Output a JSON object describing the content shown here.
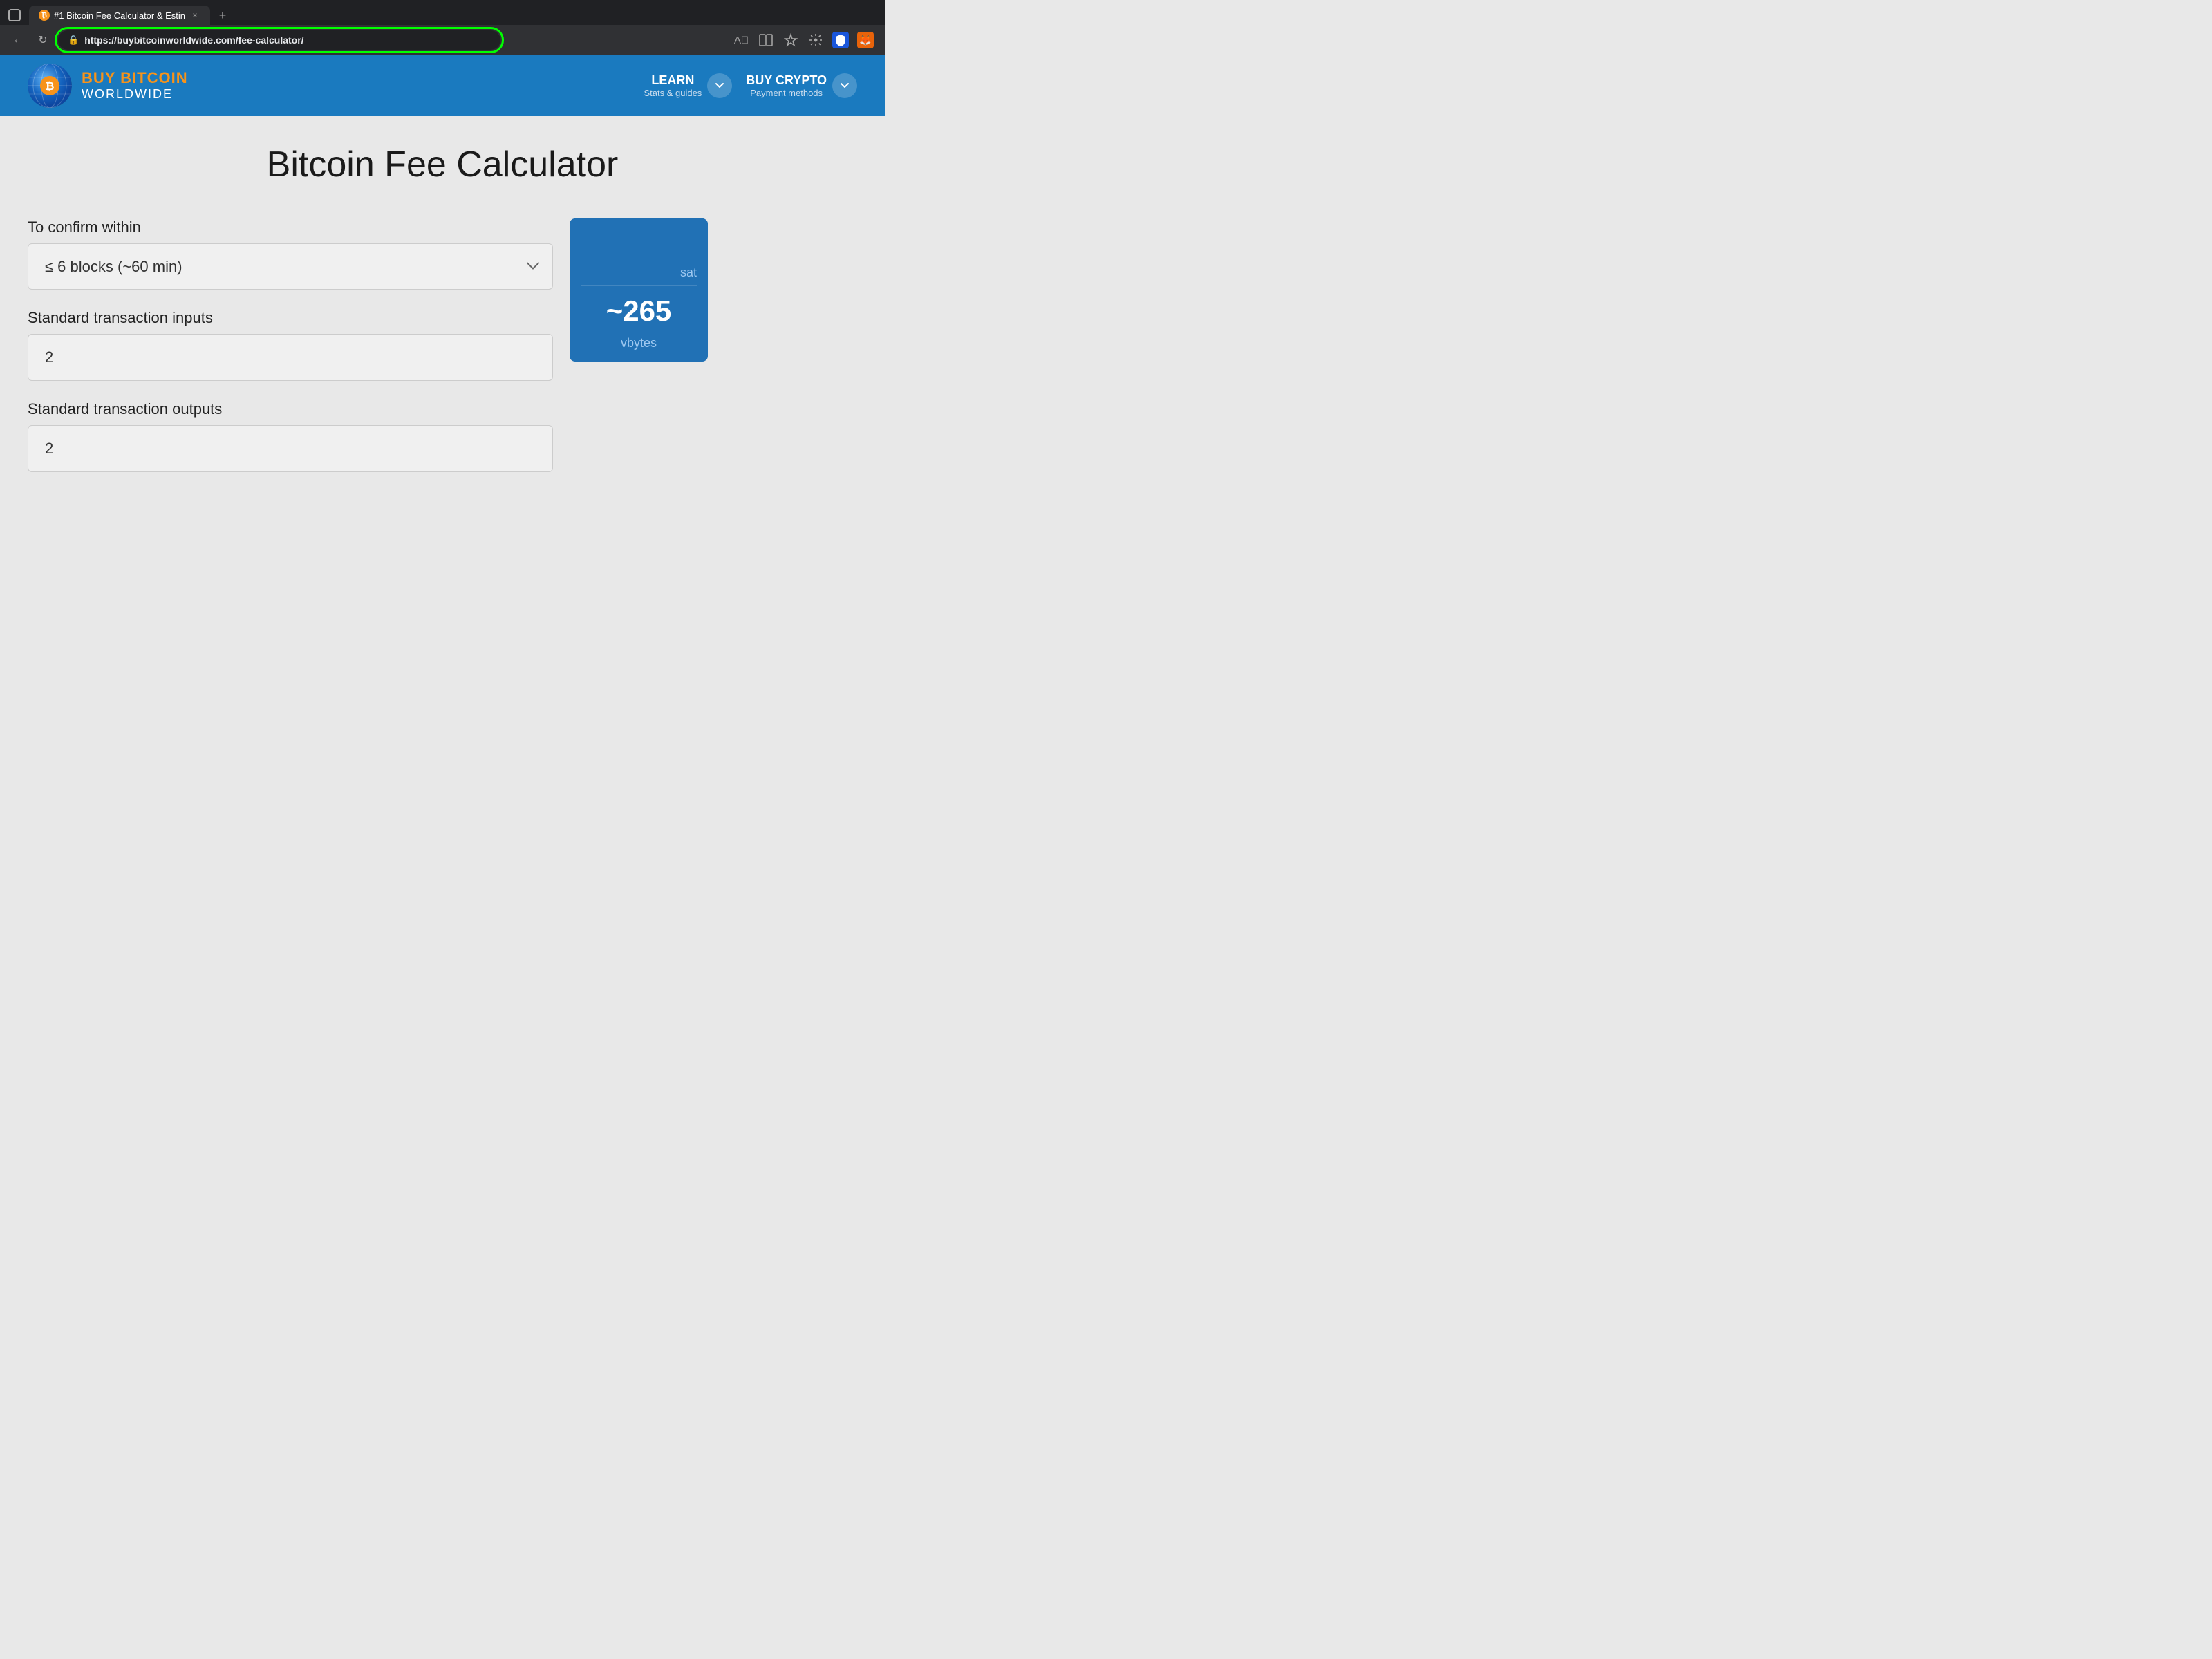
{
  "browser": {
    "tab_label": "#1 Bitcoin Fee Calculator & Estin",
    "tab_close": "×",
    "tab_new": "+",
    "url_scheme": "https://",
    "url_domain": "buybitcoinworldwide.com",
    "url_path": "/fee-calculator/",
    "back_icon": "←",
    "reload_icon": "↻",
    "read_aloud_icon": "🔊",
    "immersive_icon": "⬜",
    "favorites_icon": "☆",
    "extensions_icon": "⚙",
    "profile_icon": "👤",
    "shield_ext_label": "S",
    "fox_ext_label": "🦊"
  },
  "nav": {
    "logo_top": "BUY BITCOIN",
    "logo_bottom": "WORLDWIDE",
    "learn_main": "LEARN",
    "learn_sub": "Stats & guides",
    "buy_crypto_main": "BUY CRYPTO",
    "buy_crypto_sub": "Payment methods"
  },
  "page": {
    "title": "Bitcoin Fee Calculator"
  },
  "form": {
    "confirm_label": "To confirm within",
    "confirm_value": "≤ 6 blocks (~60 min)",
    "inputs_label": "Standard transaction inputs",
    "inputs_value": "2",
    "outputs_label": "Standard transaction outputs",
    "outputs_value": "2"
  },
  "result": {
    "sats_label": "sat",
    "vbytes_value": "~265",
    "vbytes_unit": "vbytes",
    "sats_value": "~"
  }
}
